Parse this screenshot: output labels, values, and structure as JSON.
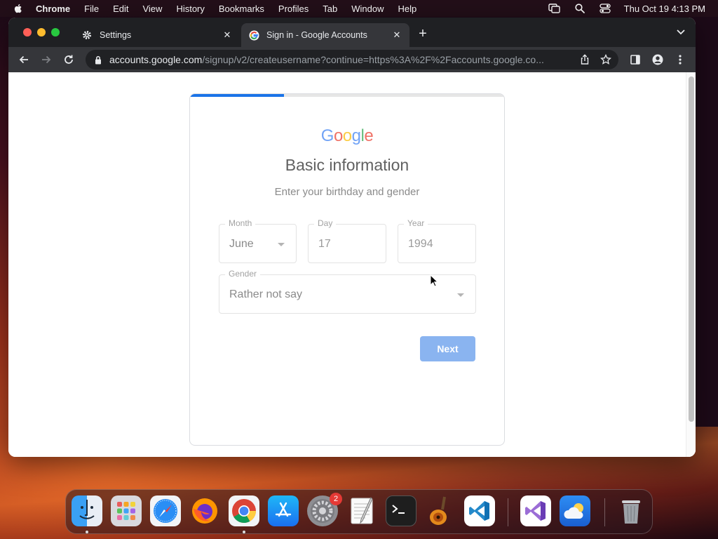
{
  "menubar": {
    "app": "Chrome",
    "items": [
      "File",
      "Edit",
      "View",
      "History",
      "Bookmarks",
      "Profiles",
      "Tab",
      "Window",
      "Help"
    ],
    "clock": "Thu Oct 19  4:13 PM"
  },
  "browser": {
    "tabs": [
      {
        "label": "Settings",
        "icon": "gear-icon",
        "active": false
      },
      {
        "label": "Sign in - Google Accounts",
        "icon": "google-g-icon",
        "active": true
      }
    ],
    "url_host": "accounts.google.com",
    "url_rest": "/signup/v2/createusername?continue=https%3A%2F%2Faccounts.google.co..."
  },
  "page": {
    "logo": "Google",
    "title": "Basic information",
    "subtitle": "Enter your birthday and gender",
    "progress": 0.3,
    "month": {
      "label": "Month",
      "value": "June"
    },
    "day": {
      "label": "Day",
      "value": "17"
    },
    "year": {
      "label": "Year",
      "value": "1994"
    },
    "gender": {
      "label": "Gender",
      "value": "Rather not say"
    },
    "next_label": "Next"
  },
  "dock": {
    "apps": [
      "finder-icon",
      "launchpad-icon",
      "safari-icon",
      "firefox-icon",
      "chrome-icon",
      "app-store-icon",
      "system-settings-icon",
      "textedit-icon",
      "terminal-icon",
      "garageband-icon",
      "vscode-icon",
      "visual-studio-icon",
      "weather-icon",
      "trash-icon"
    ],
    "settings_badge": "2"
  },
  "colors": {
    "accent": "#1a73e8",
    "next_button": "#8ab4f0",
    "google_blue": "#4285f4",
    "google_red": "#ea4335",
    "google_yellow": "#fbbc05",
    "google_green": "#34a853"
  }
}
